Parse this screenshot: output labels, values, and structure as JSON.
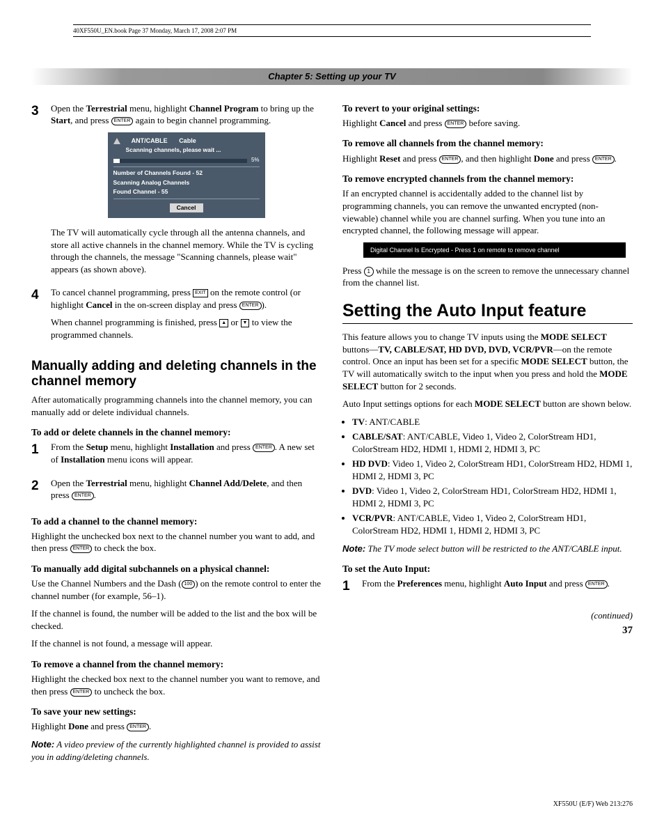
{
  "meta": {
    "topline": "40XF550U_EN.book  Page 37  Monday, March 17, 2008  2:07 PM"
  },
  "chapter": "Chapter 5: Setting up your TV",
  "left": {
    "step3": {
      "num": "3",
      "p1a": "Open the ",
      "b1": "Terrestrial",
      "p1b": " menu, highlight ",
      "b2": "Channel Program",
      "p1c": " to bring up the ",
      "b3": "Start",
      "p1d": ", and press ",
      "p1e": " again to begin channel programming."
    },
    "osd": {
      "tab1": "ANT/CABLE",
      "tab2": "Cable",
      "scanning": "Scanning channels, please wait ...",
      "pct": "5%",
      "found": "Number of Channels Found - 52",
      "analog": "Scanning Analog Channels",
      "foundch": "Found Channel - 55",
      "cancel": "Cancel"
    },
    "step3b": "The TV will automatically cycle through all the antenna channels, and store all active channels in the channel memory. While the TV is cycling through the channels, the message \"Scanning channels, please wait\" appears (as shown above).",
    "step4": {
      "num": "4",
      "p1a": "To cancel channel programming, press ",
      "key_exit": "EXIT",
      "p1b": " on the remote control (or highlight ",
      "b1": "Cancel",
      "p1c": " in the on-screen display and press ",
      "p1d": ").",
      "p2a": "When channel programming is finished, press ",
      "p2b": " or ",
      "p2c": " to view the programmed channels."
    },
    "h2a": "Manually adding and deleting channels in the channel memory",
    "intro": "After automatically programming channels into the channel memory, you can manually add or delete individual channels.",
    "sub1": "To add or delete channels in the channel memory:",
    "s1": {
      "num": "1",
      "a": "From the ",
      "b1": "Setup",
      "b": " menu, highlight ",
      "b2": "Installation",
      "c": " and press ",
      "d": ". A new set of ",
      "b3": "Installation",
      "e": " menu icons will appear."
    },
    "s2": {
      "num": "2",
      "a": "Open the ",
      "b1": "Terrestrial",
      "b": " menu, highlight ",
      "b2": "Channel Add/Delete",
      "c": ", and then press ",
      "d": "."
    },
    "sub2": "To add a channel to the channel memory:",
    "p2a": "Highlight the unchecked box next to the channel number you want to add, and then press ",
    "p2b": " to check the box.",
    "sub3": "To manually add digital subchannels on a physical channel:",
    "p3a": "Use the Channel Numbers and the Dash (",
    "key100": "100",
    "p3b": ") on the remote control to enter the channel number (for example, 56–1).",
    "p3c": "If the channel is found, the number will be added to the list and the box will be checked.",
    "p3d": "If the channel is not found, a message will appear.",
    "sub4": "To remove a channel from the channel memory:",
    "p4a": "Highlight the checked box next to the channel number you want to remove, and then press ",
    "p4b": " to uncheck the box.",
    "sub5": "To save your new settings:",
    "p5a": "Highlight ",
    "b5": "Done",
    "p5b": " and press ",
    "p5c": ".",
    "note1_label": "Note:",
    "note1": " A video preview of the currently highlighted channel is provided to assist you in adding/deleting channels."
  },
  "right": {
    "sub1": "To revert to your original settings:",
    "p1a": "Highlight ",
    "b1": "Cancel",
    "p1b": " and press ",
    "p1c": " before saving.",
    "sub2": "To remove all channels from the channel memory:",
    "p2a": "Highlight ",
    "b2a": "Reset",
    "p2b": " and press ",
    "p2c": ", and then highlight ",
    "b2b": "Done",
    "p2d": " and press ",
    "p2e": ".",
    "sub3": "To remove encrypted channels from the channel memory:",
    "p3": "If an encrypted channel is accidentally added to the channel list by programming channels, you can remove the unwanted encrypted (non-viewable) channel while you are channel surfing. When you tune into an encrypted channel, the following message will appear.",
    "blackbox": "Digital Channel Is Encrypted - Press 1 on remote to remove channel",
    "p4a": "Press ",
    "p4b": " while the message is on the screen to remove the unnecessary channel from the channel list.",
    "h1": "Setting the Auto Input feature",
    "intro_a": "This feature allows you to change TV inputs using the ",
    "b_mode": "MODE SELECT",
    "intro_b": " buttons—",
    "b_inputs": "TV, CABLE/SAT, HD DVD, DVD, VCR/PVR",
    "intro_c": "—on the remote control. Once an input has been set for a specific ",
    "intro_d": " button, the TV will automatically switch to the input when you press and hold the ",
    "intro_e": " button for 2 seconds.",
    "intro2a": "Auto Input settings options for each ",
    "intro2b": " button are shown below.",
    "li1a": "TV",
    "li1b": ": ANT/CABLE",
    "li2a": "CABLE/SAT",
    "li2b": ": ANT/CABLE, Video 1, Video 2, ColorStream HD1, ColorStream HD2, HDMI 1, HDMI 2, HDMI 3, PC",
    "li3a": "HD DVD",
    "li3b": ": Video 1, Video 2, ColorStream HD1, ColorStream HD2, HDMI 1, HDMI 2, HDMI 3, PC",
    "li4a": "DVD",
    "li4b": ": Video 1, Video 2, ColorStream HD1, ColorStream HD2, HDMI 1, HDMI 2, HDMI 3, PC",
    "li5a": "VCR/PVR",
    "li5b": ": ANT/CABLE, Video 1, Video 2, ColorStream HD1, ColorStream HD2, HDMI 1, HDMI 2, HDMI 3, PC",
    "note_label": "Note:",
    "note": " The TV mode select button will be restricted to the ANT/CABLE input.",
    "sub4": "To set the Auto Input:",
    "s1": {
      "num": "1",
      "a": "From the ",
      "b1": "Preferences",
      "b": " menu, highlight ",
      "b2": "Auto Input",
      "c": " and press ",
      "d": "."
    },
    "continued": "(continued)"
  },
  "page": "37",
  "footer": "XF550U (E/F) Web 213:276",
  "icons": {
    "enter": "ENTER",
    "one": "1",
    "ch_up": "▲",
    "ch_dn": "▼"
  }
}
